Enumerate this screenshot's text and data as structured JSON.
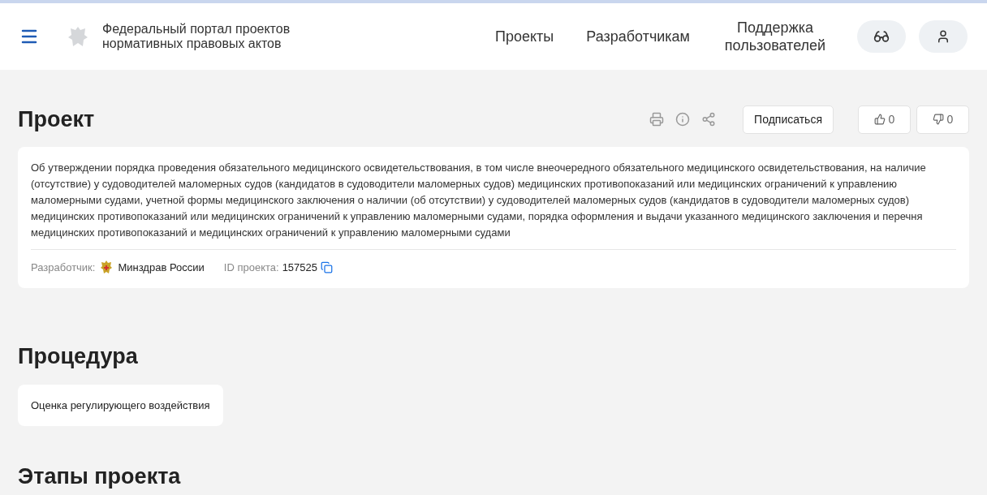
{
  "header": {
    "portal_title": "Федеральный портал проектов нормативных правовых актов",
    "nav": [
      "Проекты",
      "Разработчикам",
      "Поддержка пользователей"
    ]
  },
  "project": {
    "heading": "Проект",
    "subscribe": "Подписаться",
    "likes": "0",
    "dislikes": "0",
    "description": "Об утверждении порядка проведения обязательного медицинского освидетельствования, в том числе внеочередного обязательного медицинского освидетельствования, на наличие (отсутствие) у судоводителей маломерных судов (кандидатов в судоводители маломерных судов) медицинских противопоказаний или медицинских ограничений к управлению маломерными судами, учетной формы медицинского заключения о наличии (об отсутствии) у судоводителей маломерных судов (кандидатов в судоводители маломерных судов) медицинских противопоказаний или медицинских ограничений к управлению маломерными судами, порядка оформления и выдачи указанного медицинского заключения и перечня медицинских противопоказаний и медицинских ограничений к управлению маломерными судами",
    "developer_label": "Разработчик:",
    "developer": "Минздрав России",
    "id_label": "ID проекта:",
    "id": "157525"
  },
  "procedure": {
    "heading": "Процедура",
    "value": "Оценка регулирующего воздействия"
  },
  "stages": {
    "heading": "Этапы проекта"
  }
}
